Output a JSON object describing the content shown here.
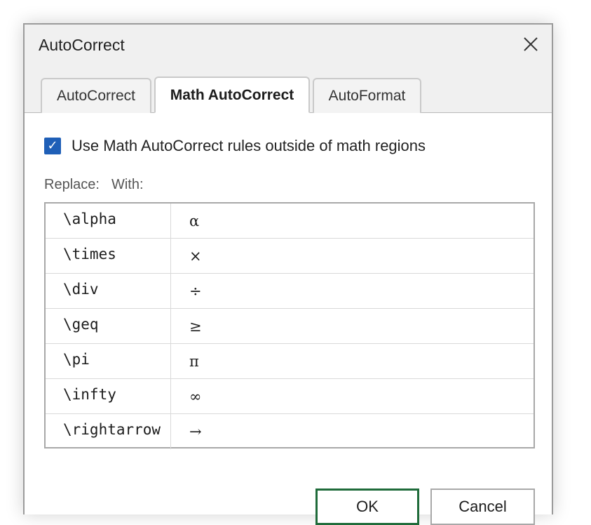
{
  "dialog": {
    "title": "AutoCorrect",
    "close_icon": "close-icon"
  },
  "tabs": [
    {
      "label": "AutoCorrect",
      "active": false
    },
    {
      "label": "Math AutoCorrect",
      "active": true
    },
    {
      "label": "AutoFormat",
      "active": false
    }
  ],
  "option": {
    "checked": true,
    "label": "Use Math AutoCorrect rules outside of math regions"
  },
  "columns": {
    "replace": "Replace:",
    "with": "With:"
  },
  "rules": [
    {
      "replace": "\\alpha",
      "with": "α"
    },
    {
      "replace": "\\times",
      "with": "×"
    },
    {
      "replace": "\\div",
      "with": "÷"
    },
    {
      "replace": "\\geq",
      "with": "≥"
    },
    {
      "replace": "\\pi",
      "with": "π"
    },
    {
      "replace": "\\infty",
      "with": "∞"
    },
    {
      "replace": "\\rightarrow",
      "with": "→"
    }
  ],
  "buttons": {
    "ok": "OK",
    "cancel": "Cancel"
  },
  "colors": {
    "checkbox": "#1f5fb7",
    "ok_border": "#1f6b3a"
  }
}
